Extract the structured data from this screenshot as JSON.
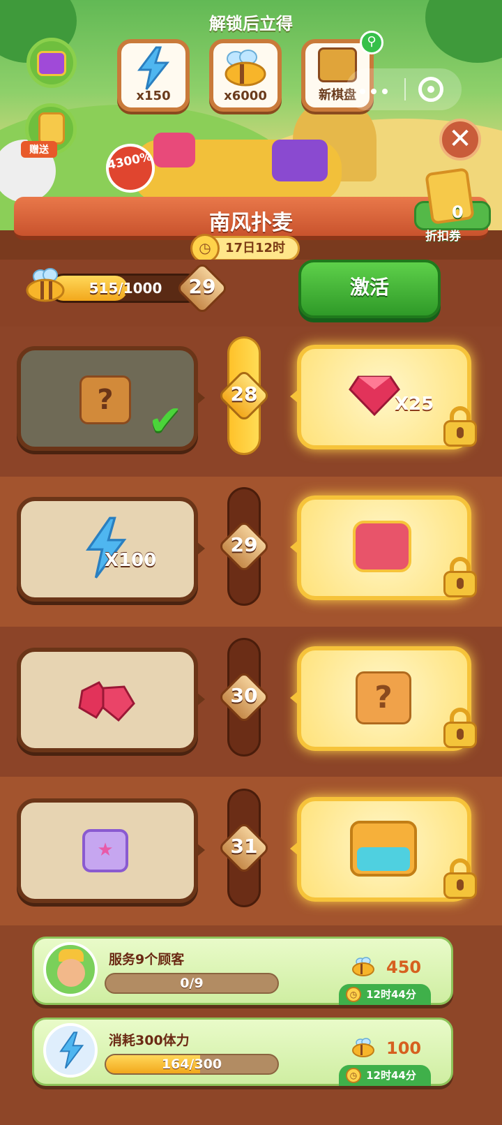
{
  "header": {
    "unlock_title": "解锁后立得",
    "rewards": [
      {
        "icon": "energy-bolt-icon",
        "value": "x150"
      },
      {
        "icon": "honey-bee-icon",
        "value": "x6000"
      },
      {
        "icon": "new-board-icon",
        "value": "新棋盘"
      }
    ],
    "gift_label": "赠送",
    "percent_badge": "4300%",
    "event_title": "南风扑麦",
    "timer": "17日12时",
    "discount": {
      "count": "0",
      "label": "折扣券"
    }
  },
  "progress": {
    "current": 515,
    "total": 1000,
    "text": "515/1000",
    "level": "29",
    "fill_fraction": 0.515,
    "activate_label": "激活"
  },
  "levels": [
    {
      "level": "28",
      "free": {
        "icon": "mystery-box-icon",
        "label": "",
        "claimed": true
      },
      "paid": {
        "icon": "ruby-gem-icon",
        "label": "X25"
      },
      "track_active": true
    },
    {
      "level": "29",
      "free": {
        "icon": "energy-bolt-icon",
        "label": "X100",
        "claimed": false
      },
      "paid": {
        "icon": "red-chest-icon",
        "label": ""
      },
      "track_active": false
    },
    {
      "level": "30",
      "free": {
        "icon": "ruby-pile-icon",
        "label": "",
        "claimed": false
      },
      "paid": {
        "icon": "mystery-box-icon",
        "label": ""
      },
      "track_active": false
    },
    {
      "level": "31",
      "free": {
        "icon": "purple-chest-icon",
        "label": "",
        "claimed": false
      },
      "paid": {
        "icon": "treasure-chest-icon",
        "label": ""
      },
      "track_active": false
    }
  ],
  "tasks": [
    {
      "title": "服务9个顾客",
      "progress_text": "0/9",
      "fill_fraction": 0,
      "reward": "450",
      "time": "12时44分",
      "avatar": "farmer-avatar-icon"
    },
    {
      "title": "消耗300体力",
      "progress_text": "164/300",
      "fill_fraction": 0.547,
      "reward": "100",
      "time": "12时44分",
      "avatar": "energy-avatar-icon"
    }
  ],
  "colors": {
    "accent_green": "#2f9a28",
    "gold": "#f6c33a",
    "wood": "#8e4628"
  }
}
